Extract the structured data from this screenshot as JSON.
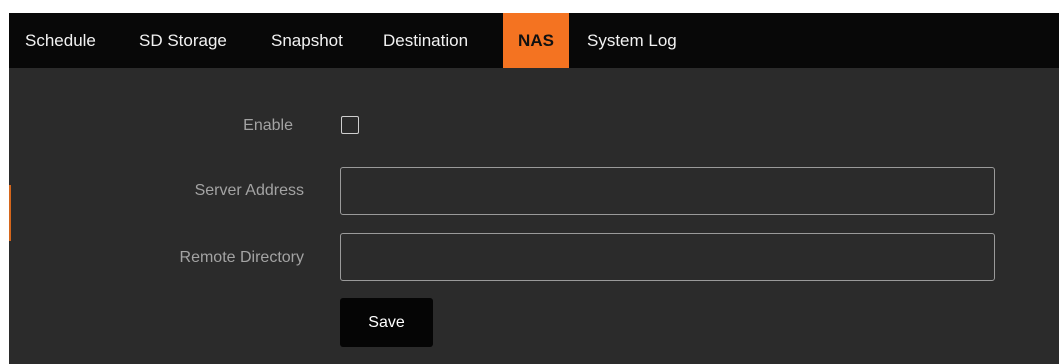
{
  "tabs": [
    {
      "label": "Schedule",
      "active": false
    },
    {
      "label": "SD Storage",
      "active": false
    },
    {
      "label": "Snapshot",
      "active": false
    },
    {
      "label": "Destination",
      "active": false
    },
    {
      "label": "NAS",
      "active": true
    },
    {
      "label": "System Log",
      "active": false
    }
  ],
  "form": {
    "enable_label": "Enable",
    "enable_checked": false,
    "server_address_label": "Server Address",
    "server_address_value": "",
    "remote_directory_label": "Remote Directory",
    "remote_directory_value": "",
    "save_label": "Save"
  },
  "colors": {
    "tab_bar_background": "#080808",
    "active_tab_accent": "#f47321",
    "panel_background": "#2b2b2b",
    "label_text": "#a3a3a3",
    "button_background": "#050505"
  }
}
